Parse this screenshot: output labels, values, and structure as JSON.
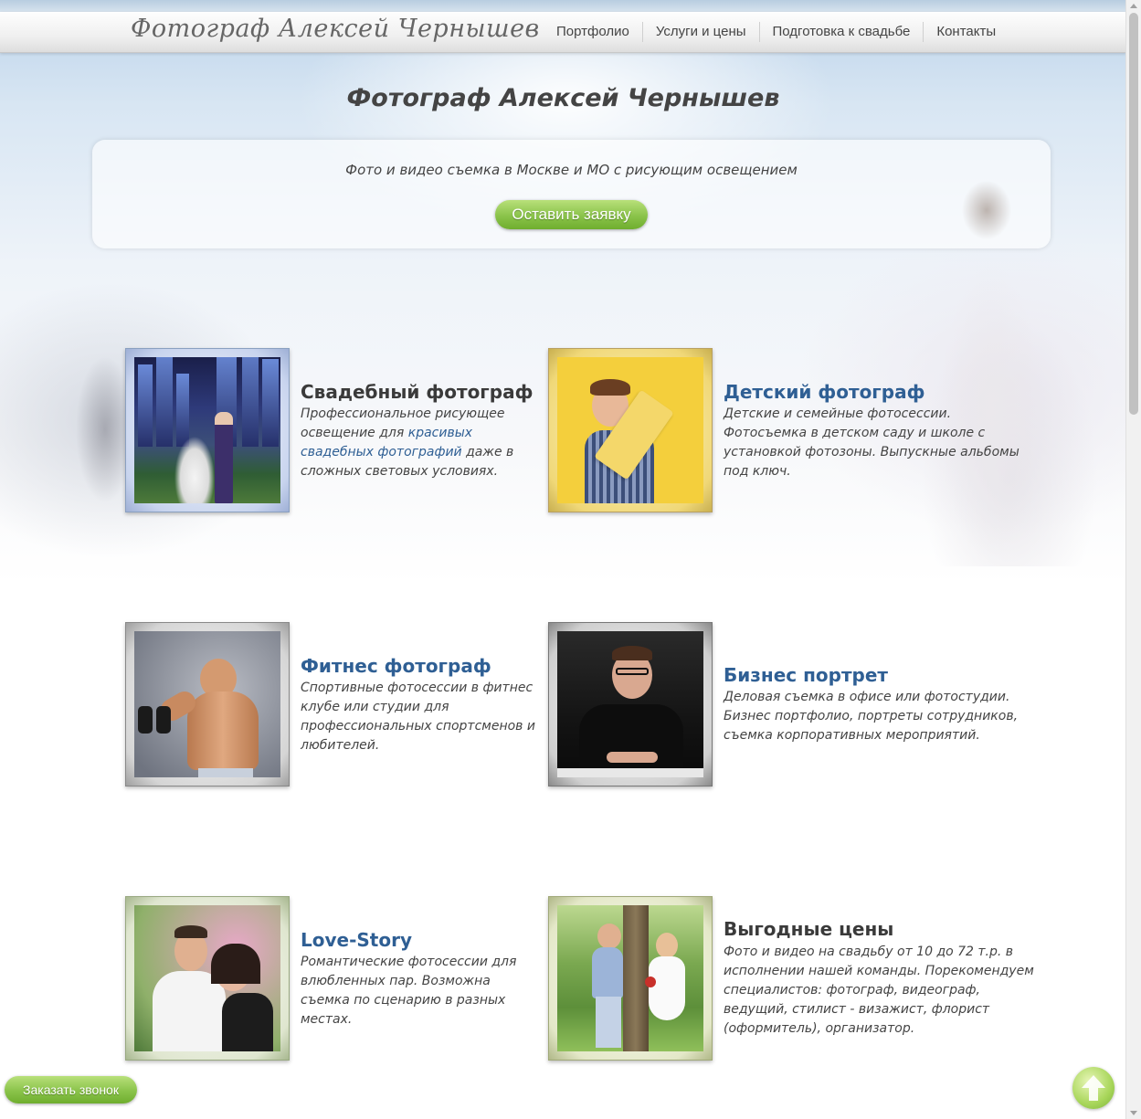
{
  "header": {
    "logo": "Фотограф Алексей Чернышев",
    "nav": [
      "Портфолио",
      "Услуги и цены",
      "Подготовка к свадьбе",
      "Контакты"
    ]
  },
  "hero": {
    "title": "Фотограф Алексей Чернышев",
    "subtitle": "Фото и видео съемка в Москве и МО с рисующим освещением",
    "cta": "Оставить заявку"
  },
  "services": {
    "wedding": {
      "title": "Свадебный фотограф",
      "text_before": "Профессиональное рисующее освещение для ",
      "link": "красивых свадебных фотографий",
      "text_after": " даже в сложных световых условиях."
    },
    "kids": {
      "title": "Детский фотограф",
      "text": "Детские и семейные фотосессии. Фотосъемка в детском саду и школе с установкой фотозоны. Выпускные альбомы под ключ."
    },
    "fitness": {
      "title": "Фитнес фотограф",
      "text": "Спортивные фотосессии в фитнес клубе или студии для профессиональных спортсменов и любителей."
    },
    "business": {
      "title": "Бизнес портрет",
      "text": "Деловая съемка в офисе или фотостудии. Бизнес портфолио, портреты сотрудников, съемка корпоративных мероприятий."
    },
    "love": {
      "title": "Love-Story",
      "text": "Романтические фотосессии для влюбленных пар. Возможна съемка по сценарию в разных местах."
    },
    "prices": {
      "title": "Выгодные цены",
      "text": "Фото и видео на свадьбу от 10 до 72 т.р. в исполнении нашей команды. Порекомендуем специалистов: фотограф, видеограф, ведущий, стилист - визажист, флорист (оформитель), организатор."
    }
  },
  "floating": {
    "callback": "Заказать звонок",
    "to_top_icon": "arrow-up-icon"
  },
  "colors": {
    "accent_green": "#8ac34a",
    "link_blue": "#2f5f94"
  }
}
